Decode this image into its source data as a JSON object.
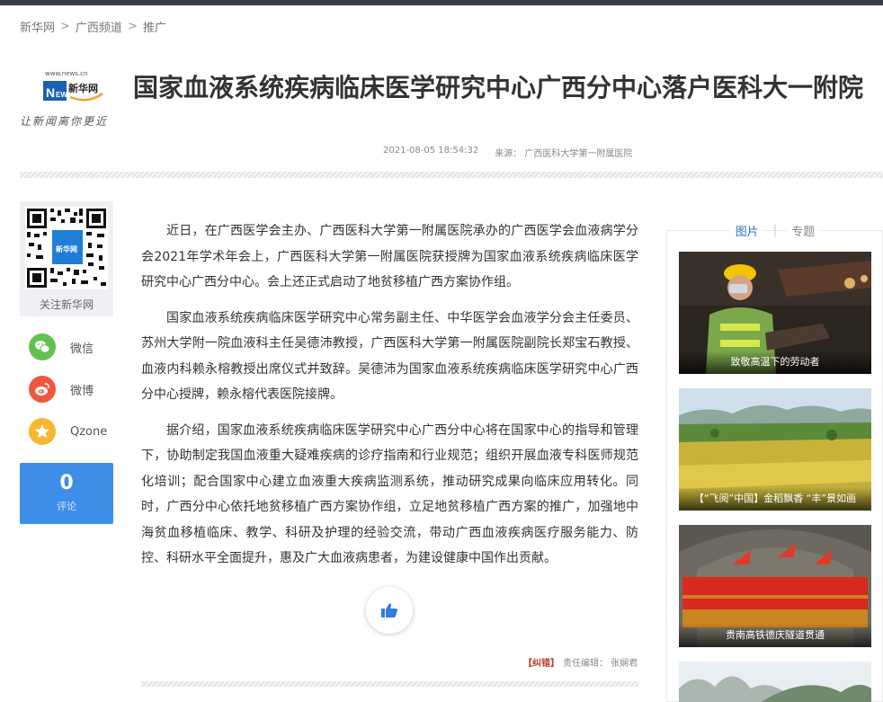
{
  "breadcrumb": [
    "新华网",
    "广西频道",
    "推广"
  ],
  "breadcrumb_sep": ">",
  "logo": {
    "url_text": "www.news.cn",
    "brand_cn": "新华网",
    "brand_en": "NEWS",
    "slogan": "让新闻离你更近"
  },
  "article": {
    "title": "国家血液系统疾病临床医学研究中心广西分中心落户医科大一附院",
    "datetime": "2021-08-05 18:54:32",
    "source": "来源：  广西医科大学第一附属医院",
    "paragraphs": [
      "近日，在广西医学会主办、广西医科大学第一附属医院承办的广西医学会血液病学分会2021年学术年会上，广西医科大学第一附属医院获授牌为国家血液系统疾病临床医学研究中心广西分中心。会上还正式启动了地贫移植广西方案协作组。",
      "国家血液系统疾病临床医学研究中心常务副主任、中华医学会血液学分会主任委员、苏州大学附一院血液科主任吴德沛教授，广西医科大学第一附属医院副院长郑宝石教授、血液内科赖永榕教授出席仪式并致辞。吴德沛为国家血液系统疾病临床医学研究中心广西分中心授牌，赖永榕代表医院接牌。",
      "据介绍，国家血液系统疾病临床医学研究中心广西分中心将在国家中心的指导和管理下，协助制定我国血液重大疑难疾病的诊疗指南和行业规范；组织开展血液专科医师规范化培训；配合国家中心建立血液重大疾病监测系统，推动研究成果向临床应用转化。同时，广西分中心依托地贫移植广西方案协作组，立足地贫移植广西方案的推广，加强地中海贫血移植临床、教学、科研及护理的经验交流，带动广西血液疾病医疗服务能力、防控、科研水平全面提升，惠及广大血液病患者，为建设健康中国作出贡献。"
    ],
    "correction_tag": "【纠错】",
    "editor": "责任编辑：  张娴君"
  },
  "share": {
    "qr_label": "关注新华网",
    "qr_badge": "新华网",
    "items": [
      {
        "label": "微信",
        "icon": "wechat-icon",
        "color": "#62c24f"
      },
      {
        "label": "微博",
        "icon": "weibo-icon",
        "color": "#f0573e"
      },
      {
        "label": "Qzone",
        "icon": "qzone-icon",
        "color": "#f7b731"
      }
    ],
    "comments": {
      "count": "0",
      "label": "评论"
    }
  },
  "sidebar": {
    "tabs": [
      "图片",
      "专题"
    ],
    "active_tab": "图片",
    "cards": [
      {
        "caption": "致敬高温下的劳动者"
      },
      {
        "caption": "【“飞阅”中国】金稻飘香 “丰”景如画"
      },
      {
        "caption": "贵南高铁德庆隧道贯通"
      },
      {
        "caption": ""
      }
    ]
  },
  "colors": {
    "accent_blue": "#3e8ee8",
    "tab_active": "#2b73c6",
    "correction_red": "#c0392b"
  }
}
